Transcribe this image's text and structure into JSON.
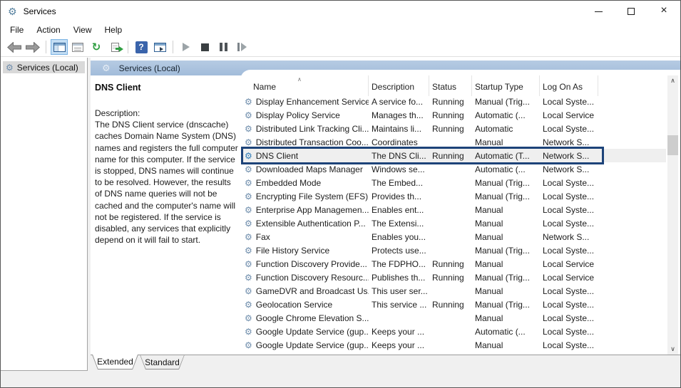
{
  "window": {
    "title": "Services",
    "controls": {
      "minimize": "minimize",
      "maximize": "maximize",
      "close": "close"
    }
  },
  "menu": {
    "items": [
      {
        "label": "File"
      },
      {
        "label": "Action"
      },
      {
        "label": "View"
      },
      {
        "label": "Help"
      }
    ]
  },
  "toolbar": {
    "items": [
      "back",
      "forward",
      "show-console-tree",
      "properties",
      "refresh",
      "export-list",
      "help",
      "show-action-pane",
      "start-service",
      "stop-service",
      "pause-service",
      "restart-service"
    ],
    "selected_item": "show-console-tree"
  },
  "tree": {
    "items": [
      {
        "label": "Services (Local)",
        "selected": true
      }
    ]
  },
  "main": {
    "header": "Services (Local)",
    "detail": {
      "title": "DNS Client",
      "description_label": "Description:",
      "description": "The DNS Client service (dnscache) caches Domain Name System (DNS) names and registers the full computer name for this computer. If the service is stopped, DNS names will continue to be resolved. However, the results of DNS name queries will not be cached and the computer's name will not be registered. If the service is disabled, any services that explicitly depend on it will fail to start."
    },
    "table": {
      "columns": [
        "Name",
        "Description",
        "Status",
        "Startup Type",
        "Log On As"
      ],
      "sorted_column": "Name",
      "sort_direction": "ascending",
      "rows": [
        {
          "name": "Display Enhancement Service",
          "description": "A service fo...",
          "status": "Running",
          "startup_type": "Manual (Trig...",
          "log_on_as": "Local Syste...",
          "highlighted": false
        },
        {
          "name": "Display Policy Service",
          "description": "Manages th...",
          "status": "Running",
          "startup_type": "Automatic (...",
          "log_on_as": "Local Service",
          "highlighted": false
        },
        {
          "name": "Distributed Link Tracking Cli...",
          "description": "Maintains li...",
          "status": "Running",
          "startup_type": "Automatic",
          "log_on_as": "Local Syste...",
          "highlighted": false
        },
        {
          "name": "Distributed Transaction Coo...",
          "description": "Coordinates",
          "status": "",
          "startup_type": "Manual",
          "log_on_as": "Network S...",
          "highlighted": false
        },
        {
          "name": "DNS Client",
          "description": "The DNS Cli...",
          "status": "Running",
          "startup_type": "Automatic (T...",
          "log_on_as": "Network S...",
          "highlighted": true
        },
        {
          "name": "Downloaded Maps Manager",
          "description": "Windows se...",
          "status": "",
          "startup_type": "Automatic (...",
          "log_on_as": "Network S...",
          "highlighted": false
        },
        {
          "name": "Embedded Mode",
          "description": "The Embed...",
          "status": "",
          "startup_type": "Manual (Trig...",
          "log_on_as": "Local Syste...",
          "highlighted": false
        },
        {
          "name": "Encrypting File System (EFS)",
          "description": "Provides th...",
          "status": "",
          "startup_type": "Manual (Trig...",
          "log_on_as": "Local Syste...",
          "highlighted": false
        },
        {
          "name": "Enterprise App Managemen...",
          "description": "Enables ent...",
          "status": "",
          "startup_type": "Manual",
          "log_on_as": "Local Syste...",
          "highlighted": false
        },
        {
          "name": "Extensible Authentication P...",
          "description": "The Extensi...",
          "status": "",
          "startup_type": "Manual",
          "log_on_as": "Local Syste...",
          "highlighted": false
        },
        {
          "name": "Fax",
          "description": "Enables you...",
          "status": "",
          "startup_type": "Manual",
          "log_on_as": "Network S...",
          "highlighted": false
        },
        {
          "name": "File History Service",
          "description": "Protects use...",
          "status": "",
          "startup_type": "Manual (Trig...",
          "log_on_as": "Local Syste...",
          "highlighted": false
        },
        {
          "name": "Function Discovery Provide...",
          "description": "The FDPHO...",
          "status": "Running",
          "startup_type": "Manual",
          "log_on_as": "Local Service",
          "highlighted": false
        },
        {
          "name": "Function Discovery Resourc...",
          "description": "Publishes th...",
          "status": "Running",
          "startup_type": "Manual (Trig...",
          "log_on_as": "Local Service",
          "highlighted": false
        },
        {
          "name": "GameDVR and Broadcast Us...",
          "description": "This user ser...",
          "status": "",
          "startup_type": "Manual",
          "log_on_as": "Local Syste...",
          "highlighted": false
        },
        {
          "name": "Geolocation Service",
          "description": "This service ...",
          "status": "Running",
          "startup_type": "Manual (Trig...",
          "log_on_as": "Local Syste...",
          "highlighted": false
        },
        {
          "name": "Google Chrome Elevation S...",
          "description": "",
          "status": "",
          "startup_type": "Manual",
          "log_on_as": "Local Syste...",
          "highlighted": false
        },
        {
          "name": "Google Update Service (gup...",
          "description": "Keeps your ...",
          "status": "",
          "startup_type": "Automatic (...",
          "log_on_as": "Local Syste...",
          "highlighted": false
        },
        {
          "name": "Google Update Service (gup...",
          "description": "Keeps your ...",
          "status": "",
          "startup_type": "Manual",
          "log_on_as": "Local Syste...",
          "highlighted": false
        }
      ],
      "partial_row": true
    }
  },
  "tabs": {
    "items": [
      {
        "label": "Extended",
        "selected": true
      },
      {
        "label": "Standard",
        "selected": false
      }
    ]
  },
  "icons": {
    "gear": "⚙",
    "sort_ascending": "∧",
    "scroll_up": "∧",
    "scroll_down": "∨",
    "close": "×",
    "refresh": "↻",
    "help": "?"
  },
  "colors": {
    "header_blue_top": "#b6cbe3",
    "header_blue_bottom": "#a2bcda",
    "highlight_border": "#1d4379",
    "toolbar_selected_bg": "#c4def4",
    "selected_tree_item": "#d9d9d9",
    "gear_icon": "#6d8cab",
    "gear_icon_highlight": "#2d7ab6"
  }
}
